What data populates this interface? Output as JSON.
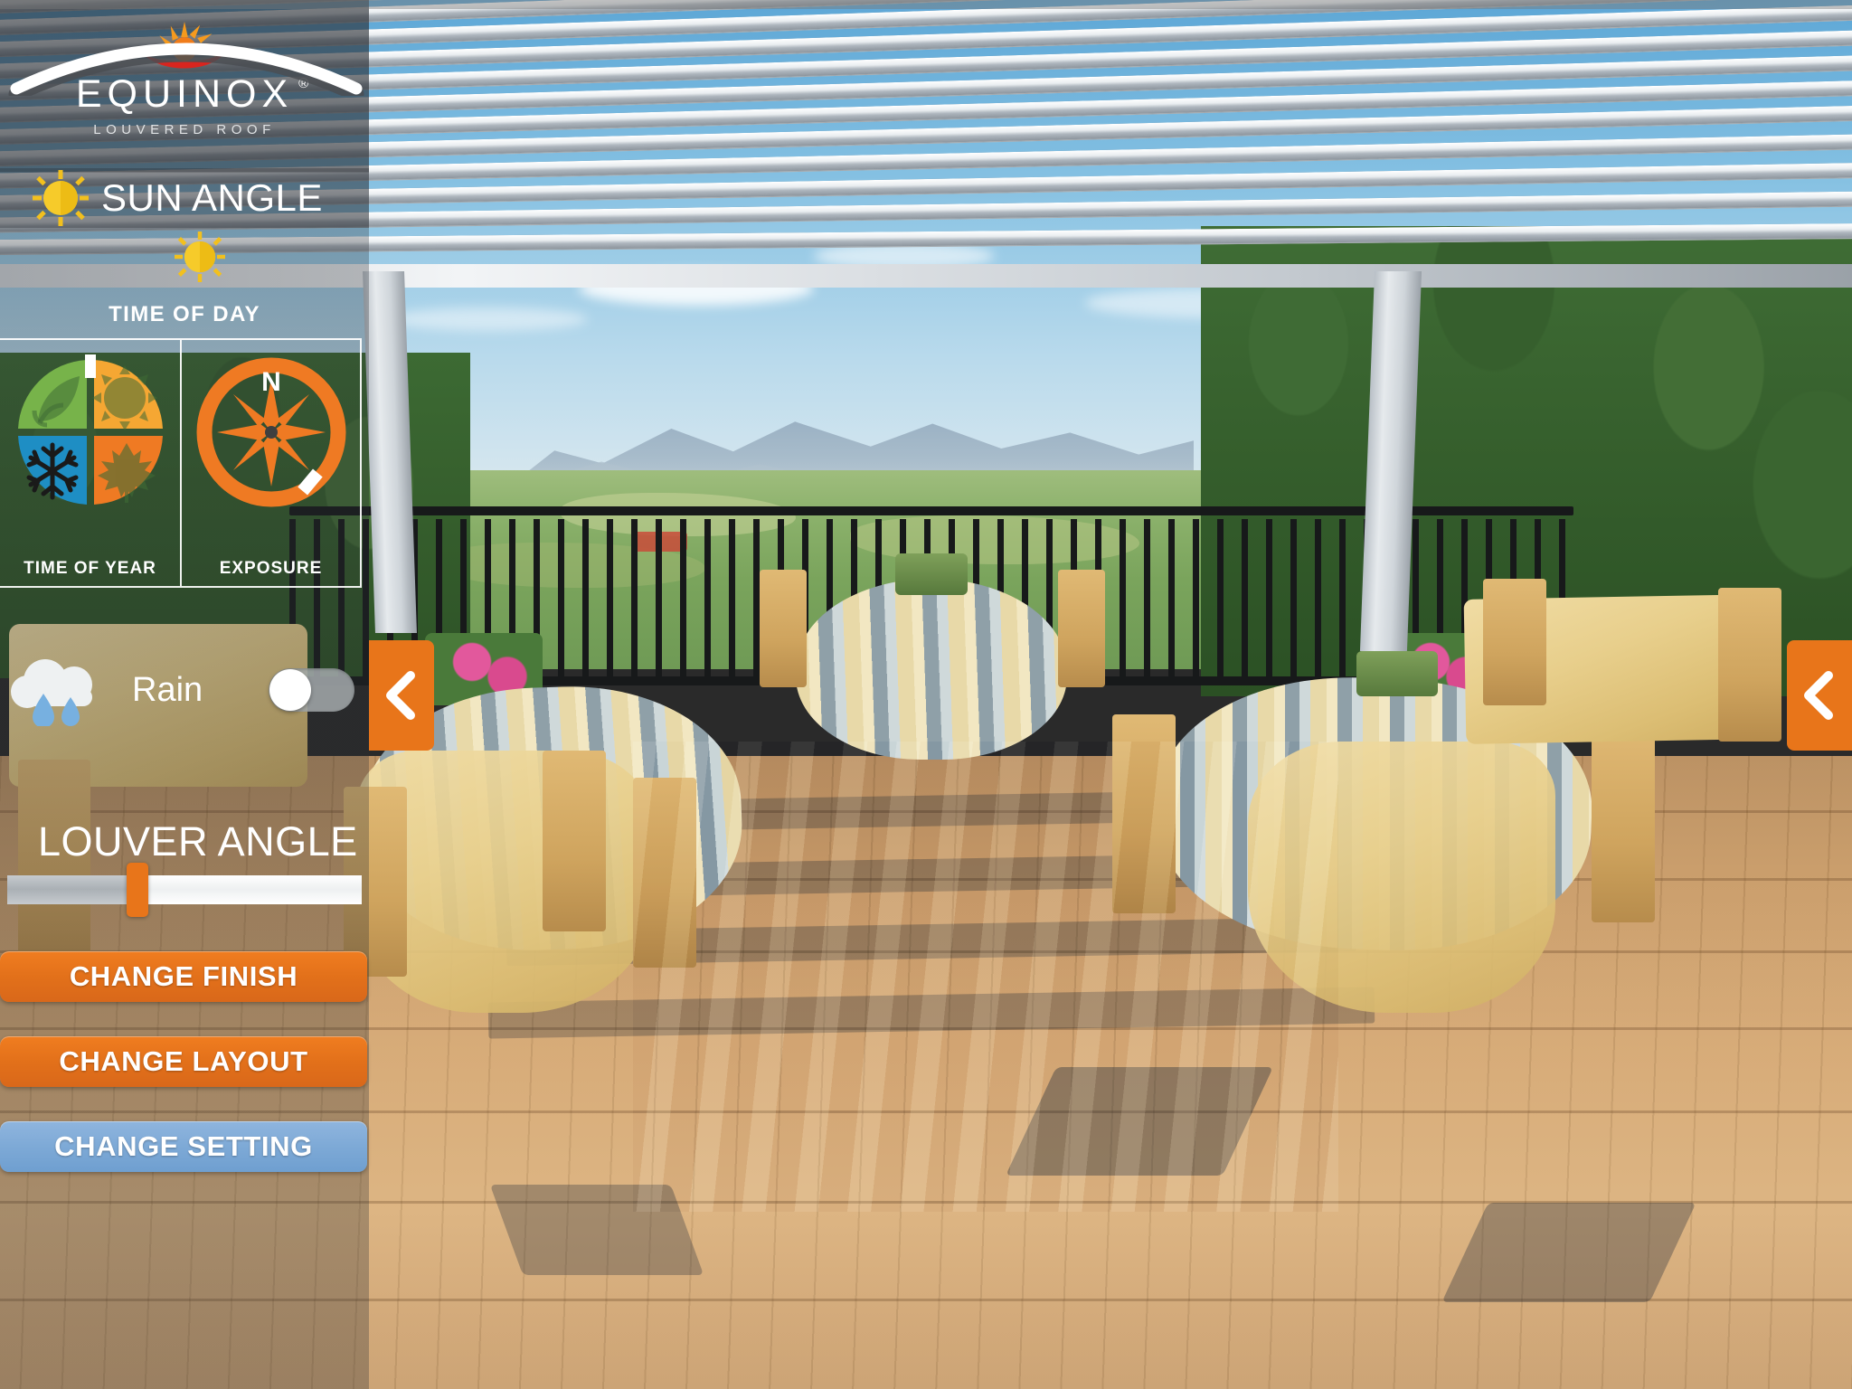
{
  "brand": {
    "name": "EQUINOX",
    "registered": "®",
    "tagline": "LOUVERED ROOF",
    "logo_icon": "sunburst-leaf-logo"
  },
  "colors": {
    "accent_orange": "#e8751a",
    "button_orange": "#e2701a",
    "button_blue": "#7da9d6",
    "season_spring": "#77b34a",
    "season_summer": "#f5a733",
    "season_winter": "#1e8ec4",
    "season_fall": "#ef7a23",
    "compass": "#ef7a23",
    "sun_yellow": "#f5c21e",
    "panel_overlay": "rgba(40,44,50,0.34)"
  },
  "sidebar": {
    "sun_angle": {
      "label": "SUN ANGLE",
      "icon": "sun-icon"
    },
    "time_of_day": {
      "label": "TIME OF DAY",
      "arc_icon": "sun-arc-track",
      "marker_icon": "sun-icon",
      "marker_position_pct": 50
    },
    "time_of_year": {
      "label": "TIME OF YEAR",
      "icon": "four-seasons-icon",
      "quadrants": [
        {
          "name": "spring",
          "glyph": "leaf-sprout-icon",
          "color": "#77b34a"
        },
        {
          "name": "summer",
          "glyph": "sun-icon",
          "color": "#f5a733"
        },
        {
          "name": "winter",
          "glyph": "snowflake-icon",
          "color": "#1e8ec4"
        },
        {
          "name": "fall",
          "glyph": "maple-leaf-icon",
          "color": "#ef7a23"
        }
      ],
      "selected_marker": "top-center-white-notch"
    },
    "exposure": {
      "label": "EXPOSURE",
      "icon": "compass-icon",
      "north_label": "N",
      "marker_position": "south-east"
    },
    "rain": {
      "label": "Rain",
      "icon": "rain-cloud-icon",
      "toggle_state": "off"
    },
    "louver_angle": {
      "label": "LOUVER ANGLE",
      "slider_value_pct": 34
    },
    "buttons": [
      {
        "label": "CHANGE FINISH",
        "style": "orange"
      },
      {
        "label": "CHANGE LAYOUT",
        "style": "orange"
      },
      {
        "label": "CHANGE SETTING",
        "style": "blue"
      }
    ]
  },
  "nav": {
    "left_arrow": {
      "icon": "chevron-left-icon"
    },
    "right_arrow": {
      "icon": "chevron-left-icon"
    }
  },
  "scene": {
    "description": "Outdoor restaurant terrace with louvered pergola roof, banquet tables with striped and gold linens, wooden chairs, black railing, valley and forested hills view"
  }
}
